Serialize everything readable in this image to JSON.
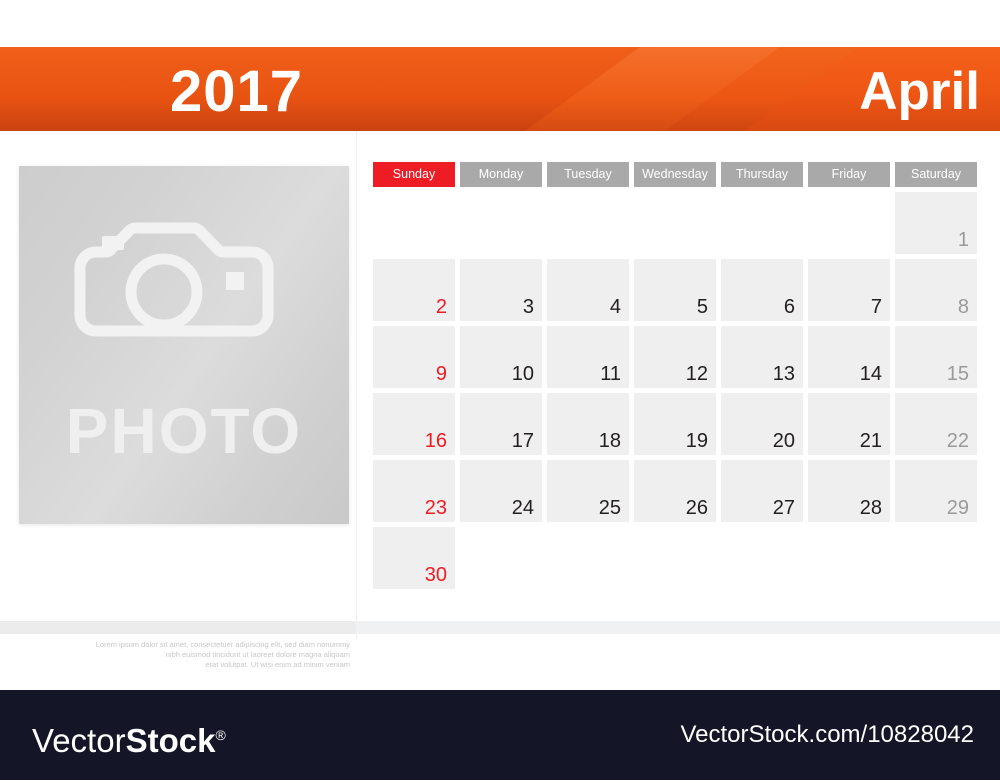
{
  "header": {
    "year": "2017",
    "month": "April"
  },
  "photo_panel": {
    "placeholder_word": "PHOTO",
    "camera_icon": "camera-icon",
    "caption_lines": [
      "Lorem ipsum dolor sit amet, consectetuer adipiscing elit, sed diam nonummy",
      "nibh euismod tincidunt ut laoreet dolore magna aliquam",
      "erat volutpat. Ut wisi enim ad minim veniam"
    ]
  },
  "calendar": {
    "day_headers": [
      "Sunday",
      "Monday",
      "Tuesday",
      "Wednesday",
      "Thursday",
      "Friday",
      "Saturday"
    ],
    "weeks": [
      [
        "",
        "",
        "",
        "",
        "",
        "",
        "1"
      ],
      [
        "2",
        "3",
        "4",
        "5",
        "6",
        "7",
        "8"
      ],
      [
        "9",
        "10",
        "11",
        "12",
        "13",
        "14",
        "15"
      ],
      [
        "16",
        "17",
        "18",
        "19",
        "20",
        "21",
        "22"
      ],
      [
        "23",
        "24",
        "25",
        "26",
        "27",
        "28",
        "29"
      ],
      [
        "30",
        "",
        "",
        "",
        "",
        "",
        ""
      ]
    ]
  },
  "footer": {
    "logo_light": "Vector",
    "logo_bold": "Stock",
    "logo_registered": "®",
    "url": "VectorStock.com/10828042"
  },
  "colors": {
    "accent_orange": "#ea5313",
    "sunday_red": "#ee1c25",
    "header_gray": "#a9a9a9",
    "cell_gray": "#efefef",
    "footer_navy": "#141627"
  }
}
